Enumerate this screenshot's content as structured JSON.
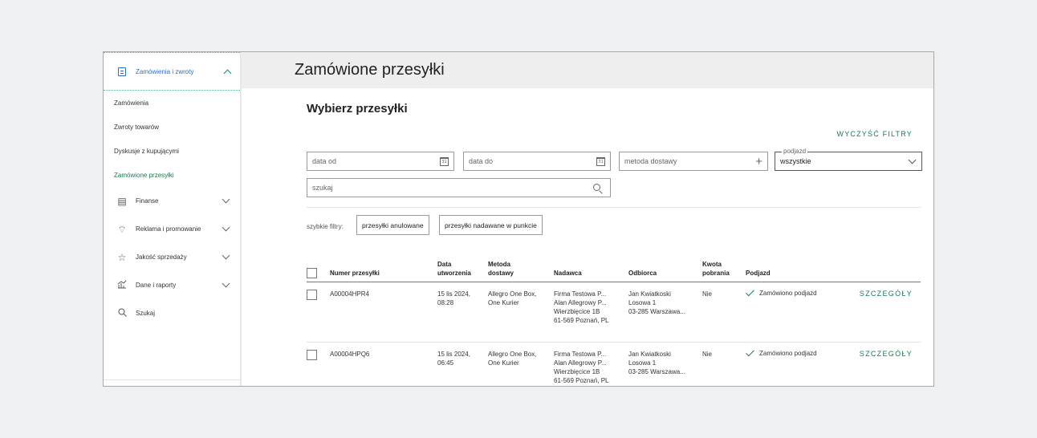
{
  "sidebar": {
    "header": {
      "label": "Zamówienia i zwroty",
      "icon": "document-icon"
    },
    "subitems": [
      {
        "label": "Zamówienia",
        "active": false
      },
      {
        "label": "Zwroty towarów",
        "active": false
      },
      {
        "label": "Dyskusje z kupującymi",
        "active": false
      },
      {
        "label": "Zamówione przesyłki",
        "active": true
      }
    ],
    "groups": [
      {
        "label": "Finanse",
        "icon": "invoice-icon"
      },
      {
        "label": "Reklama i promowanie",
        "icon": "tag-icon"
      },
      {
        "label": "Jakość sprzedaży",
        "icon": "star-icon"
      },
      {
        "label": "Dane i raporty",
        "icon": "chart-icon"
      },
      {
        "label": "Szukaj",
        "icon": "search-icon"
      }
    ]
  },
  "page": {
    "title": "Zamówione przesyłki"
  },
  "filters": {
    "heading": "Wybierz przesyłki",
    "clear_label": "WYCZYŚĆ FILTRY",
    "date_from_placeholder": "data od",
    "date_to_placeholder": "data do",
    "calendar_day": "31",
    "delivery_method_placeholder": "metoda dostawy",
    "pickup_label": "podjazd",
    "pickup_value": "wszystkie",
    "search_placeholder": "szukaj",
    "quick_filters_label": "szybkie filtry:",
    "chips": [
      "przesyłki anulowane",
      "przesyłki nadawane w punkcie"
    ]
  },
  "table": {
    "headers": {
      "number": "Numer przesyłki",
      "created_1": "Data",
      "created_2": "utworzenia",
      "method_1": "Metoda",
      "method_2": "dostawy",
      "sender": "Nadawca",
      "recipient": "Odbiorca",
      "cod_1": "Kwota",
      "cod_2": "pobrania",
      "pickup": "Podjazd"
    },
    "rows": [
      {
        "number": "A00004HPR4",
        "created_1": "15 lis 2024,",
        "created_2": "08:28",
        "method_1": "Allegro One Box,",
        "method_2": "One Kurier",
        "sender_1": "Firma Testowa P...",
        "sender_2": "Alan Allegrowy P...",
        "sender_3": "Wierzbięcice 1B",
        "sender_4": "61-569 Poznań, PL",
        "recipient_1": "Jan Kwiatkoski",
        "recipient_2": "Losowa 1",
        "recipient_3": "03-285 Warszawa...",
        "cod": "Nie",
        "pickup": "Zamówiono podjazd",
        "details": "SZCZEGÓŁY"
      },
      {
        "number": "A00004HPQ6",
        "created_1": "15 lis 2024,",
        "created_2": "06:45",
        "method_1": "Allegro One Box,",
        "method_2": "One Kurier",
        "sender_1": "Firma Testowa P...",
        "sender_2": "Alan Allegrowy P...",
        "sender_3": "Wierzbięcice 1B",
        "sender_4": "61-569 Poznań, PL",
        "recipient_1": "Jan Kwiatkoski",
        "recipient_2": "Losowa 1",
        "recipient_3": "03-285 Warszawa...",
        "cod": "Nie",
        "pickup": "Zamówiono podjazd",
        "details": "SZCZEGÓŁY"
      }
    ]
  },
  "colors": {
    "accent": "#1a7a4c",
    "link_blue": "#2e6fbf",
    "header_bg": "#eeeeee"
  }
}
